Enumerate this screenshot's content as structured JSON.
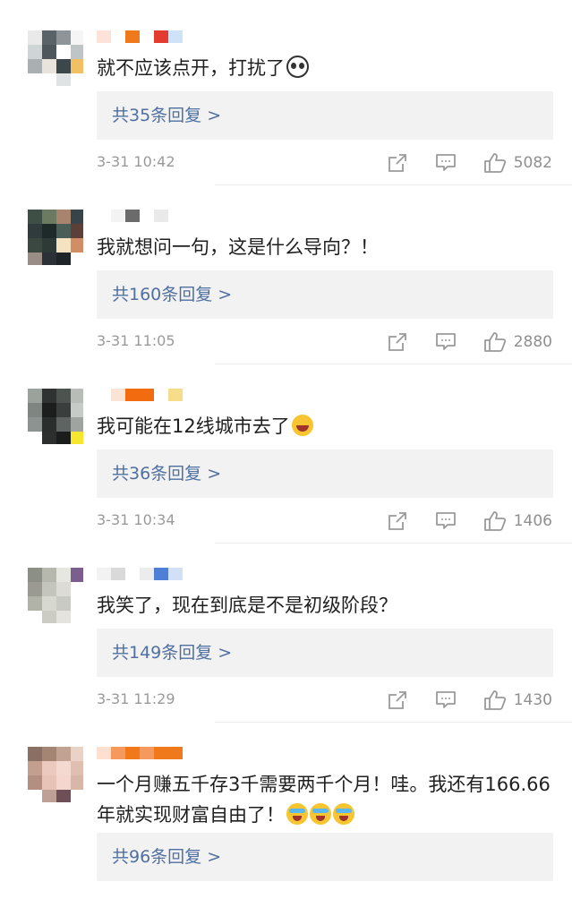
{
  "comments": [
    {
      "text": "就不应该点开，打扰了",
      "emoji": [
        "panda-emoji"
      ],
      "replies": "共35条回复 >",
      "time": "3-31 10:42",
      "likes": "5082",
      "avatar_colors": [
        "#e9e9e9",
        "#5a6468",
        "#8d9599",
        "#f5f5f5",
        "#cfd5d7",
        "#4e585c",
        "#ffffff",
        "#bfc4c6",
        "#aab0b2",
        "#e8e4dc",
        "#3c474b",
        "#f2c064",
        "#ffffff",
        "#ffffff",
        "#e0e3e4",
        "#ffffff"
      ],
      "name_colors": [
        "#fde3d7",
        "#ffffff",
        "#f07a1b",
        "#ffffff",
        "#e33b2e",
        "#cfe3f8"
      ]
    },
    {
      "text": "我就想问一句，这是什么导向？！",
      "emoji": [],
      "replies": "共160条回复 >",
      "time": "3-31 11:05",
      "likes": "2880",
      "avatar_colors": [
        "#3e4f45",
        "#6b7a60",
        "#a8836d",
        "#37444a",
        "#2f3b3c",
        "#1e2a2a",
        "#4a5d57",
        "#5c3f38",
        "#3a4841",
        "#2d3a35",
        "#f4e2c0",
        "#d18d66",
        "#9a8d86",
        "#2b3136",
        "#1f2428",
        "#ffffff"
      ],
      "name_colors": [
        "#ffffff",
        "#f3f3f3",
        "#6b6b6b",
        "#ffffff",
        "#e9e9e9",
        "#ffffff"
      ]
    },
    {
      "text": "我可能在12线城市去了",
      "emoji": [
        "laugh-emoji"
      ],
      "replies": "共36条回复 >",
      "time": "3-31 10:34",
      "likes": "1406",
      "avatar_colors": [
        "#9aa39b",
        "#2f3332",
        "#4d534f",
        "#b8bdb8",
        "#7f8682",
        "#1b1e1d",
        "#3a3f3d",
        "#c7cbc8",
        "#8d9390",
        "#2a2e2c",
        "#5e6461",
        "#9fa4a1",
        "#ffffff",
        "#2c2f2e",
        "#1a1d1c",
        "#f7e630"
      ],
      "name_colors": [
        "#ffffff",
        "#fbe4d6",
        "#f26b0f",
        "#f26b0f",
        "#ffffff",
        "#f7dc89"
      ]
    },
    {
      "text": "我笑了，现在到底是不是初级阶段？",
      "emoji": [],
      "replies": "共149条回复 >",
      "time": "3-31 11:29",
      "likes": "1430",
      "avatar_colors": [
        "#8b8f86",
        "#b6b7ad",
        "#e6e7e0",
        "#7a5e8e",
        "#9a9a92",
        "#c4c5bd",
        "#dcdcd4",
        "#ffffff",
        "#b1b3a8",
        "#d7d8cf",
        "#c9cac1",
        "#ffffff",
        "#ffffff",
        "#ccccc4",
        "#e4e4dc",
        "#ffffff"
      ],
      "name_colors": [
        "#f2f2f2",
        "#d9d9d9",
        "#ffffff",
        "#ececec",
        "#4e7fd6",
        "#cfe0f7"
      ]
    },
    {
      "text": "一个月赚五千存3千需要两千个月！哇。我还有166.66年就实现财富自由了！",
      "emoji": [
        "cry-emoji",
        "cry-emoji",
        "cry-emoji"
      ],
      "replies": "共96条回复 >",
      "time": "",
      "likes": "",
      "avatar_colors": [
        "#8b6f63",
        "#a48472",
        "#c2a293",
        "#e8d3c6",
        "#c49f8f",
        "#ebc9bf",
        "#f3d9d0",
        "#e0bfb0",
        "#b48e81",
        "#e7c2b6",
        "#f5d6cf",
        "#d9b7a8",
        "#ffffff",
        "#bfa096",
        "#6e4f58",
        "#ffffff"
      ],
      "name_colors": [
        "#fde0cf",
        "#f59a5c",
        "#f07a1b",
        "#f59a5c",
        "#f07a1b",
        "#f07a1b"
      ]
    }
  ]
}
